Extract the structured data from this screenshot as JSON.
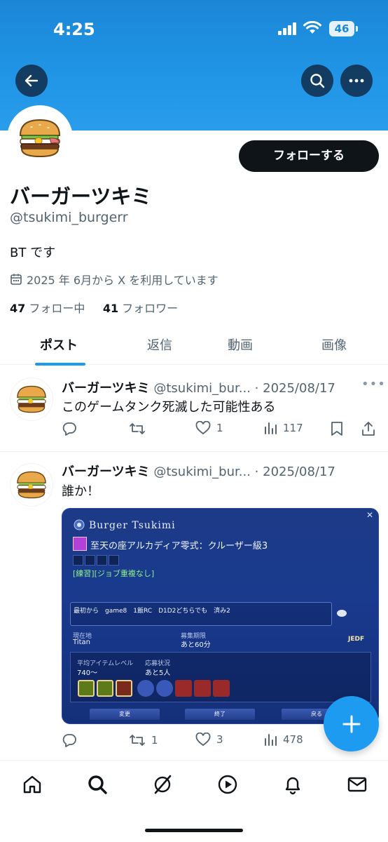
{
  "status_bar": {
    "time": "4:25",
    "battery": "46"
  },
  "profile": {
    "name": "バーガーツキミ",
    "handle": "@tsukimi_burgerr",
    "bio": "BT です",
    "joined": "2025 年 6月から X を利用しています",
    "following_count": "47",
    "following_label": "フォロー中",
    "followers_count": "41",
    "followers_label": "フォロワー",
    "follow_button": "フォローする"
  },
  "tabs": [
    {
      "label": "ポスト",
      "active": true
    },
    {
      "label": "返信",
      "active": false
    },
    {
      "label": "動画",
      "active": false
    },
    {
      "label": "画像",
      "active": false
    }
  ],
  "posts": [
    {
      "name": "バーガーツキミ",
      "handle": "@tsukimi_bur...",
      "date": "· 2025/08/17",
      "text": "このゲームタンク死滅した可能性ある",
      "reply_count": "",
      "repost_count": "",
      "like_count": "1",
      "view_count": "117"
    },
    {
      "name": "バーガーツキミ",
      "handle": "@tsukimi_bur...",
      "date": "· 2025/08/17",
      "text": "誰か！",
      "reply_count": "",
      "repost_count": "1",
      "like_count": "3",
      "view_count": "478"
    }
  ],
  "game_screenshot": {
    "title": "Burger Tsukimi",
    "duty": "至天の座アルカディア零式：クルーザー級3",
    "tag": "[練習][ジョブ重複なし]",
    "comment": "最初から　game8　1飯RC　D1D2どちらでも　済み2",
    "location_label": "現在地",
    "location": "Titan",
    "deadline_label": "募集期限",
    "deadline": "あと60分",
    "ilvl_label": "平均アイテムレベル",
    "ilvl": "740〜",
    "status_label": "応募状況",
    "status": "あと5人",
    "btn_change": "変更",
    "btn_end": "終了",
    "btn_back": "戻る",
    "ready_mark": "JEDF"
  },
  "colors": {
    "accent": "#1d9bf0",
    "banner": "#2196e6",
    "text": "#0f1419",
    "muted": "#536471"
  },
  "bottom_nav": [
    "home-icon",
    "search-icon",
    "grok-icon",
    "video-icon",
    "notifications-icon",
    "messages-icon"
  ]
}
